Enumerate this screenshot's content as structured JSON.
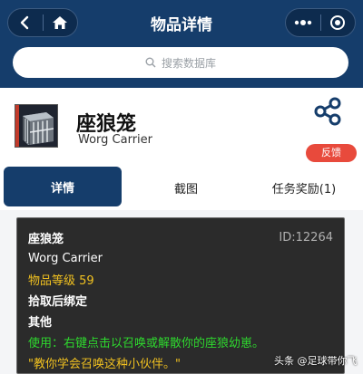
{
  "nav": {
    "title": "物品详情"
  },
  "search": {
    "placeholder": "搜索数据库"
  },
  "item": {
    "name_cn": "座狼笼",
    "name_en": "Worg Carrier"
  },
  "feedback_label": "反馈",
  "tabs": [
    {
      "label": "详情",
      "active": true
    },
    {
      "label": "截图",
      "active": false
    },
    {
      "label": "任务奖励(1)",
      "active": false
    }
  ],
  "details": {
    "name_cn": "座狼笼",
    "id": "ID:12264",
    "name_en": "Worg Carrier",
    "item_level": "物品等级 59",
    "bind": "拾取后绑定",
    "category": "其他",
    "use": "使用：右键点击以召唤或解散你的座狼幼崽。",
    "flavor": "\"教你学会召唤这种小伙伴。\""
  },
  "watermark": "头条 @足球带你飞",
  "colors": {
    "nav_bg": "#153d6b",
    "accent_red": "#e84a3c",
    "item_gold": "#f0c020",
    "use_green": "#2ed82e"
  }
}
